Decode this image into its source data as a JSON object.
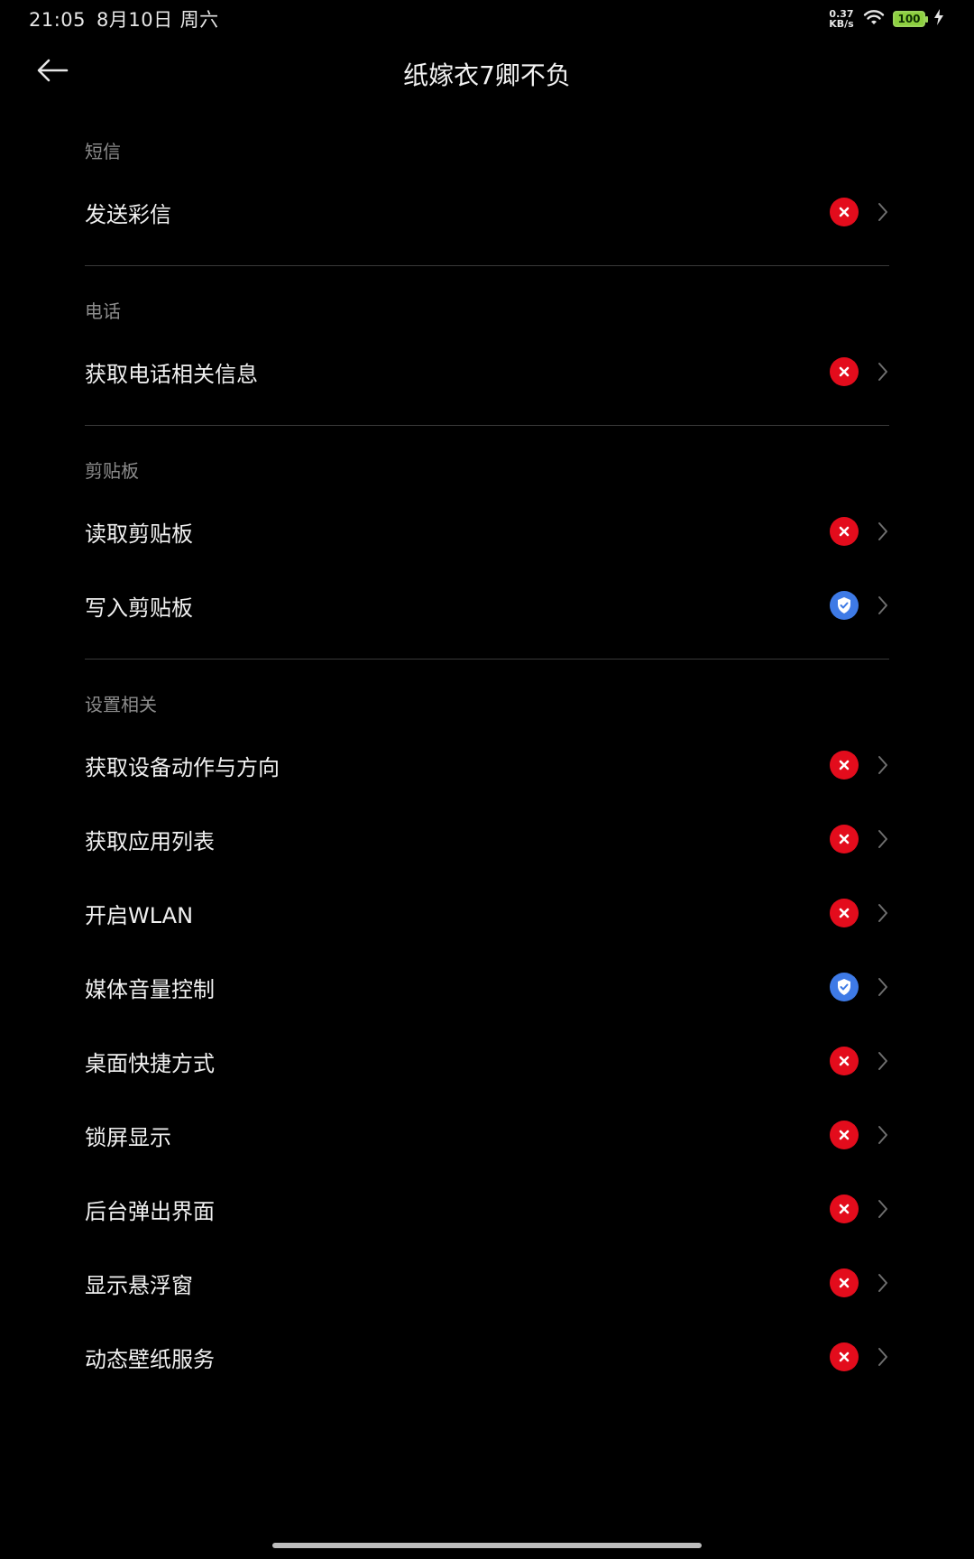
{
  "status_bar": {
    "time": "21:05",
    "date": "8月10日",
    "weekday": "周六",
    "net_speed_value": "0.37",
    "net_speed_unit": "KB/s",
    "battery_level": "100",
    "icons": [
      "wifi-icon",
      "battery-icon",
      "charging-bolt-icon"
    ]
  },
  "header": {
    "back_icon": "arrow-left-icon",
    "title": "纸嫁衣7卿不负"
  },
  "sections": [
    {
      "title": "短信",
      "items": [
        {
          "label": "发送彩信",
          "status": "denied"
        }
      ]
    },
    {
      "title": "电话",
      "items": [
        {
          "label": "获取电话相关信息",
          "status": "denied"
        }
      ]
    },
    {
      "title": "剪贴板",
      "items": [
        {
          "label": "读取剪贴板",
          "status": "denied"
        },
        {
          "label": "写入剪贴板",
          "status": "allowed"
        }
      ]
    },
    {
      "title": "设置相关",
      "items": [
        {
          "label": "获取设备动作与方向",
          "status": "denied"
        },
        {
          "label": "获取应用列表",
          "status": "denied"
        },
        {
          "label": "开启WLAN",
          "status": "denied"
        },
        {
          "label": "媒体音量控制",
          "status": "allowed"
        },
        {
          "label": "桌面快捷方式",
          "status": "denied"
        },
        {
          "label": "锁屏显示",
          "status": "denied"
        },
        {
          "label": "后台弹出界面",
          "status": "denied"
        },
        {
          "label": "显示悬浮窗",
          "status": "denied"
        },
        {
          "label": "动态壁纸服务",
          "status": "denied"
        }
      ]
    }
  ],
  "colors": {
    "background": "#000000",
    "denied": "#e30c1c",
    "allowed": "#3e7ae6",
    "section_title": "#8c8c8c",
    "divider": "#3a3a3a"
  }
}
